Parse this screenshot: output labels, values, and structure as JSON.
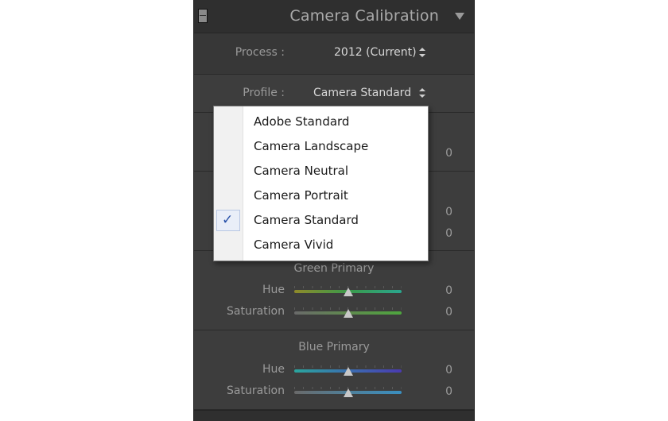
{
  "panel": {
    "title": "Camera Calibration"
  },
  "process": {
    "label": "Process :",
    "value": "2012 (Current)"
  },
  "profile": {
    "label": "Profile :",
    "value": "Camera Standard",
    "options": [
      {
        "label": "Adobe Standard",
        "selected": false
      },
      {
        "label": "Camera Landscape",
        "selected": false
      },
      {
        "label": "Camera Neutral",
        "selected": false
      },
      {
        "label": "Camera Portrait",
        "selected": false
      },
      {
        "label": "Camera Standard",
        "selected": true
      },
      {
        "label": "Camera Vivid",
        "selected": false
      }
    ],
    "check_glyph": "✓"
  },
  "hidden_values": {
    "shadows_tint": "0",
    "red_hue": "0",
    "red_saturation": "0"
  },
  "green_primary": {
    "title": "Green Primary",
    "hue": {
      "label": "Hue",
      "value": "0",
      "level": 0.5
    },
    "saturation": {
      "label": "Saturation",
      "value": "0",
      "level": 0.5
    }
  },
  "blue_primary": {
    "title": "Blue Primary",
    "hue": {
      "label": "Hue",
      "value": "0",
      "level": 0.5
    },
    "saturation": {
      "label": "Saturation",
      "value": "0",
      "level": 0.5
    }
  },
  "colors": {
    "panel_bg": "#3d3d3d",
    "menu_bg": "#ffffff",
    "check": "#2750a8"
  }
}
